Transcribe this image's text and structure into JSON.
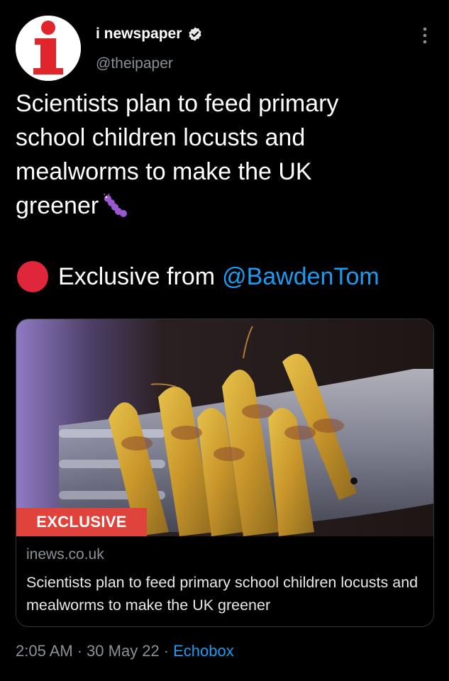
{
  "account": {
    "avatar_letter": "i",
    "name": "i newspaper",
    "handle": "@theipaper",
    "verified_icon": "verified-badge-icon"
  },
  "tweet": {
    "text": "Scientists plan to feed primary\nschool children locusts and\nmealworms to make the UK\ngreener",
    "emoji_icon": "caterpillar-icon",
    "exclusive_prefix": "Exclusive from",
    "mention": "@BawdenTom"
  },
  "card": {
    "badge": "EXCLUSIVE",
    "domain": "inews.co.uk",
    "title": "Scientists plan to feed primary school children locusts and mealworms to make the UK greener"
  },
  "meta": {
    "time": "2:05 AM",
    "date": "30 May 22",
    "separator": "·",
    "source": "Echobox"
  },
  "colors": {
    "background": "#000000",
    "link": "#1d9bf0",
    "red_dot": "#e0263b",
    "badge": "#e0433c",
    "muted": "#8b9196"
  }
}
